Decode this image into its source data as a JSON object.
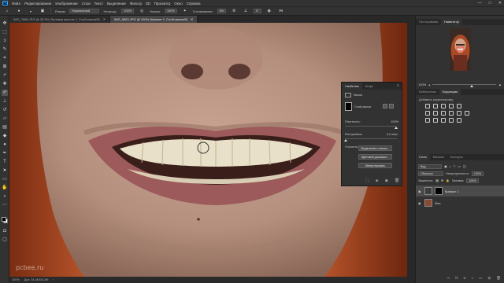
{
  "app": {
    "logo": "Ps",
    "menu": [
      "Файл",
      "Редактирование",
      "Изображение",
      "Слои",
      "Текст",
      "Выделение",
      "Фильтр",
      "3D",
      "Просмотр",
      "Окно",
      "Справка"
    ],
    "window_controls": [
      "—",
      "□",
      "✕"
    ]
  },
  "options": {
    "mode_label": "Режим:",
    "mode_value": "Нормальный",
    "opacity_label": "Непрозр.:",
    "opacity_value": "100%",
    "flow_label": "Нажим:",
    "flow_value": "100%",
    "smoothing_label": "Сглаживание:",
    "smoothing_value": "0%",
    "angle_value": "0°"
  },
  "tabs": [
    {
      "label": "IMG_7886.JPG @ 33,3% (Заливка цветом 1, Слой-маска/8)",
      "close": "✕",
      "active": false
    },
    {
      "label": "IMG_9824.JPG @ 100% (Кривые 1, Слой-маска/8)",
      "close": "✕",
      "active": true
    }
  ],
  "status": {
    "zoom": "100%",
    "doc_info": "Док: 34,3M/34,3M"
  },
  "watermark": "pcbee.ru",
  "properties": {
    "tab_active": "Свойства",
    "tab_other": "Инфо",
    "close": "✕",
    "kind_label": "Маски",
    "mask_label": "Слой-маска",
    "density_label": "Плотность:",
    "density_value": "100%",
    "feather_label": "Растушевка:",
    "feather_value": "0,0 пикс.",
    "refine_label": "Уточнить:",
    "btn_select_mask": "Выделение и маска...",
    "btn_color_range": "Цветовой диапазон...",
    "btn_invert": "Инвертировать"
  },
  "right": {
    "top_tabs": [
      "Гистограмма",
      "Навигатор"
    ],
    "top_tab_active": "Навигатор",
    "zoom_value": "100%",
    "mid_tabs": [
      "Библиотеки",
      "Коррекция"
    ],
    "mid_tab_active": "Коррекция",
    "adj_title": "Добавить корректировку",
    "layers_tabs": [
      "Слои",
      "Каналы",
      "Контуры"
    ],
    "layers_tab_active": "Слои",
    "kind_filter": "Вид",
    "blend_mode": "Обычные",
    "opacity_label": "Непрозрачность:",
    "opacity_value": "100%",
    "lock_label": "Закрепить:",
    "fill_label": "Заливка:",
    "fill_value": "100%",
    "layers": [
      {
        "name": "Кривые 1",
        "selected": true
      },
      {
        "name": "Фон",
        "selected": false
      }
    ]
  },
  "tools": [
    "move",
    "marquee",
    "lasso",
    "quick-select",
    "crop",
    "frame",
    "eyedropper",
    "healing",
    "brush",
    "stamp",
    "history-brush",
    "eraser",
    "gradient",
    "blur",
    "dodge",
    "pen",
    "type",
    "path-select",
    "shape",
    "hand",
    "zoom",
    "more"
  ],
  "colors": {
    "accent": "#31a8ff",
    "panel": "#323232",
    "canvas_bg": "#282828",
    "skin": "#b48f7e",
    "lips": "#9c5a5a",
    "teeth": "#e8e0c8",
    "hair": "#a84a25"
  }
}
